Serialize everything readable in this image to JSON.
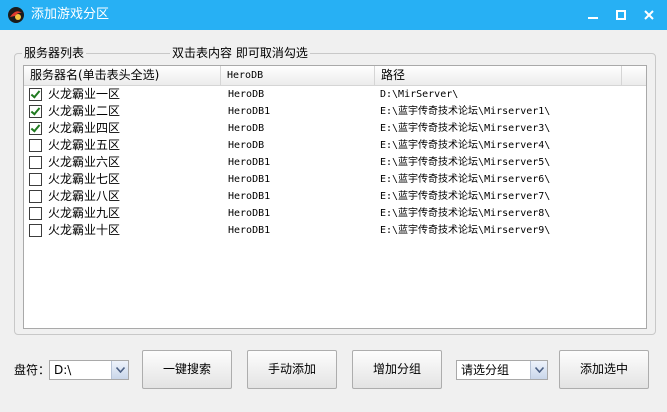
{
  "window": {
    "title": "添加游戏分区"
  },
  "group": {
    "legend": "服务器列表",
    "hint": "双击表内容 即可取消勾选"
  },
  "list": {
    "columns": [
      "服务器名(单击表头全选)",
      "HeroDB",
      "路径",
      ""
    ],
    "rows": [
      {
        "checked": true,
        "name": "火龙霸业一区",
        "db": "HeroDB",
        "path": "D:\\MirServer\\"
      },
      {
        "checked": true,
        "name": "火龙霸业二区",
        "db": "HeroDB1",
        "path": "E:\\蓝宇传奇技术论坛\\Mirserver1\\"
      },
      {
        "checked": true,
        "name": "火龙霸业四区",
        "db": "HeroDB",
        "path": "E:\\蓝宇传奇技术论坛\\Mirserver3\\"
      },
      {
        "checked": false,
        "name": "火龙霸业五区",
        "db": "HeroDB",
        "path": "E:\\蓝宇传奇技术论坛\\Mirserver4\\"
      },
      {
        "checked": false,
        "name": "火龙霸业六区",
        "db": "HeroDB1",
        "path": "E:\\蓝宇传奇技术论坛\\Mirserver5\\"
      },
      {
        "checked": false,
        "name": "火龙霸业七区",
        "db": "HeroDB1",
        "path": "E:\\蓝宇传奇技术论坛\\Mirserver6\\"
      },
      {
        "checked": false,
        "name": "火龙霸业八区",
        "db": "HeroDB1",
        "path": "E:\\蓝宇传奇技术论坛\\Mirserver7\\"
      },
      {
        "checked": false,
        "name": "火龙霸业九区",
        "db": "HeroDB1",
        "path": "E:\\蓝宇传奇技术论坛\\Mirserver8\\"
      },
      {
        "checked": false,
        "name": "火龙霸业十区",
        "db": "HeroDB1",
        "path": "E:\\蓝宇传奇技术论坛\\Mirserver9\\"
      }
    ]
  },
  "bottom": {
    "drive_label": "盘符：",
    "drive_value": "D:\\",
    "search_button": "一键搜索",
    "manual_add_button": "手动添加",
    "add_group_button": "增加分组",
    "group_select_value": "请选分组",
    "add_selected_button": "添加选中"
  },
  "colors": {
    "titlebar": "#27b0f4",
    "checkmark": "#1f7a1f"
  },
  "icons": {
    "app": "app-logo-icon",
    "minimize": "minimize-icon",
    "maximize": "maximize-icon",
    "close": "close-icon",
    "dropdown": "chevron-down-icon"
  }
}
